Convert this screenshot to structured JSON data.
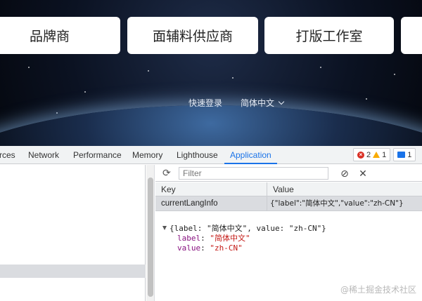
{
  "hero": {
    "cards": [
      "品牌商",
      "面辅料供应商",
      "打版工作室",
      ""
    ],
    "quick_login": "快速登录",
    "language": "简体中文"
  },
  "devtools": {
    "tabs": [
      "rces",
      "Network",
      "Performance",
      "Memory",
      "Lighthouse",
      "Application"
    ],
    "active_tab": "Application",
    "badges": {
      "errors": "2",
      "warnings": "1",
      "messages": "1"
    },
    "toolbar": {
      "filter_placeholder": "Filter"
    },
    "table": {
      "columns": [
        "Key",
        "Value"
      ],
      "rows": [
        {
          "key": "currentLangInfo",
          "value": "{\"label\":\"简体中文\",\"value\":\"zh-CN\"}"
        }
      ]
    },
    "preview": {
      "summary": "{label: \"简体中文\", value: \"zh-CN\"}",
      "props": [
        {
          "name": "label",
          "value": "\"简体中文\""
        },
        {
          "name": "value",
          "value": "\"zh-CN\""
        }
      ]
    }
  },
  "watermark": "@稀土掘金技术社区",
  "colors": {
    "accent": "#1a73e8",
    "error": "#d93025",
    "warning": "#f9ab00",
    "string": "#c41a16",
    "property": "#881280"
  }
}
